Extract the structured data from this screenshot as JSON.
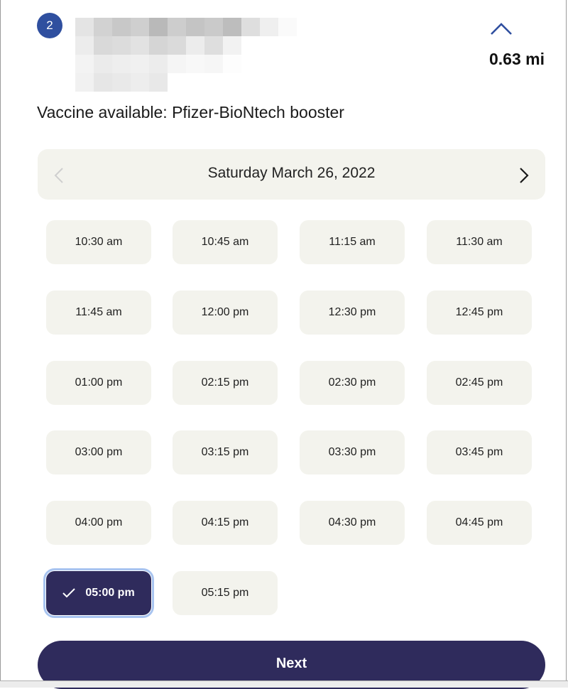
{
  "location": {
    "step_number": "2",
    "distance": "0.63 mi",
    "vaccine_text": "Vaccine available: Pfizer-BioNtech booster",
    "collapse_icon": "chevron-up-icon"
  },
  "date_nav": {
    "date": "Saturday March 26, 2022",
    "prev_icon": "chevron-left-icon",
    "next_icon": "chevron-right-icon"
  },
  "slots": [
    {
      "time": "10:30 am"
    },
    {
      "time": "10:45 am"
    },
    {
      "time": "11:15 am"
    },
    {
      "time": "11:30 am"
    },
    {
      "time": "11:45 am"
    },
    {
      "time": "12:00 pm"
    },
    {
      "time": "12:30 pm"
    },
    {
      "time": "12:45 pm"
    },
    {
      "time": "01:00 pm"
    },
    {
      "time": "02:15 pm"
    },
    {
      "time": "02:30 pm"
    },
    {
      "time": "02:45 pm"
    },
    {
      "time": "03:00 pm"
    },
    {
      "time": "03:15 pm"
    },
    {
      "time": "03:30 pm"
    },
    {
      "time": "03:45 pm"
    },
    {
      "time": "04:00 pm"
    },
    {
      "time": "04:15 pm"
    },
    {
      "time": "04:30 pm"
    },
    {
      "time": "04:45 pm"
    },
    {
      "time": "05:00 pm",
      "selected": true
    },
    {
      "time": "05:15 pm"
    }
  ],
  "next_button": {
    "label": "Next"
  },
  "colors": {
    "accent": "#2f2b5c",
    "badge": "#2f4f9f",
    "slot_bg": "#f3f3ed",
    "focus_ring": "#a8c4f0"
  }
}
